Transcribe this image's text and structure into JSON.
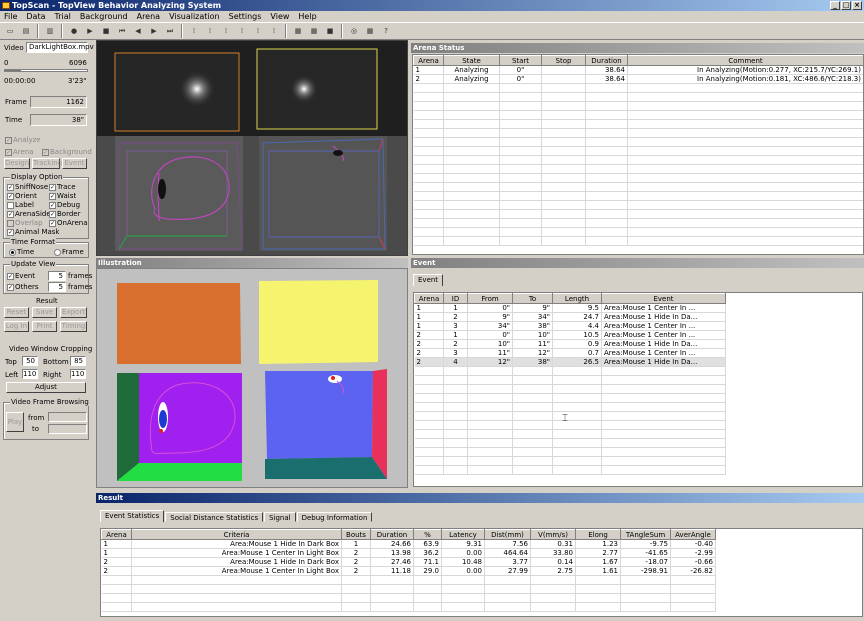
{
  "app": {
    "title": "TopScan - TopView Behavior Analyzing System"
  },
  "window_controls": {
    "minimize": "_",
    "maximize": "□",
    "close": "×"
  },
  "menu": [
    "File",
    "Data",
    "Trial",
    "Background",
    "Arena",
    "Visualization",
    "Settings",
    "View",
    "Help"
  ],
  "toolbar": {
    "icons": [
      "new-icon",
      "open-icon",
      "save-icon",
      "play-icon",
      "record-icon",
      "stop-icon",
      "rewind-icon",
      "back-icon",
      "forward-icon",
      "fast-forward-icon",
      "step1-icon",
      "step2-icon",
      "step3-icon",
      "step4-icon",
      "step5-icon",
      "step6-icon",
      "view1-icon",
      "view2-icon",
      "view3-icon",
      "capture-icon",
      "grid-icon",
      "help-icon"
    ]
  },
  "left": {
    "video_label": "Video",
    "video_file": "DarkLightBox.mpv",
    "slider_min": "0",
    "slider_max": "6096",
    "slider_fraction": 0.19,
    "time_start": "00:00:00",
    "time_end": "3'23\"",
    "frame_label": "Frame",
    "frame_value": "1162",
    "time_label": "Time",
    "time_value": "38\"",
    "analyze": "Analyze",
    "arena": "Arena",
    "background": "Background",
    "design": "Design",
    "tracking": "Tracking",
    "event": "Event",
    "display_option": "Display Option",
    "opts": [
      {
        "label": "SniffNose",
        "checked": true
      },
      {
        "label": "Trace",
        "checked": true
      },
      {
        "label": "Orient",
        "checked": true
      },
      {
        "label": "Waist",
        "checked": true
      },
      {
        "label": "Label",
        "checked": false
      },
      {
        "label": "Debug",
        "checked": true
      },
      {
        "label": "ArenaSide",
        "checked": true
      },
      {
        "label": "Border",
        "checked": true
      },
      {
        "label": "Overlap",
        "checked": false
      },
      {
        "label": "OnArena",
        "checked": true
      },
      {
        "label": "Animal Mask",
        "checked": true
      }
    ],
    "time_format": "Time Format",
    "tf_time": "Time",
    "tf_frame": "Frame",
    "update_view": "Update View",
    "uv_event": "Event",
    "uv_event_n": "5",
    "uv_others": "Others",
    "uv_others_n": "5",
    "frames": "frames",
    "result": "Result",
    "reset": "Reset",
    "save": "Save",
    "export": "Export",
    "login": "Log In",
    "print": "Print",
    "timing": "Timing",
    "cropping": "Video Window Cropping",
    "top": "Top",
    "top_v": "50",
    "bottom": "Bottom",
    "bottom_v": "85",
    "left_l": "Left",
    "left_v": "110",
    "right_l": "Right",
    "right_v": "110",
    "adjust": "Adjust",
    "browsing": "Video Frame Browsing",
    "play": "Play",
    "from": "from",
    "to": "to"
  },
  "illustration_title": "Illustration",
  "arena_status": {
    "title": "Arena Status",
    "columns": [
      "Arena",
      "State",
      "Start",
      "Stop",
      "Duration",
      "Comment"
    ],
    "rows": [
      [
        "1",
        "Analyzing",
        "0\"",
        "",
        "38.64",
        "In Analyzing(Motion:0.277, XC:215.7/YC:269.1)"
      ],
      [
        "2",
        "Analyzing",
        "0\"",
        "",
        "38.64",
        "In Analyzing(Motion:0.181, XC:486.6/YC:218.3)"
      ]
    ]
  },
  "event_panel": {
    "title": "Event",
    "tab": "Event",
    "columns": [
      "Arena",
      "ID",
      "From",
      "To",
      "Length",
      "Event"
    ],
    "rows": [
      [
        "1",
        "1",
        "0\"",
        "9\"",
        "9.5",
        "Area:Mouse 1 Center In ..."
      ],
      [
        "1",
        "2",
        "9\"",
        "34\"",
        "24.7",
        "Area:Mouse 1 Hide In Da..."
      ],
      [
        "1",
        "3",
        "34\"",
        "38\"",
        "4.4",
        "Area:Mouse 1 Center In ..."
      ],
      [
        "2",
        "1",
        "0\"",
        "10\"",
        "10.5",
        "Area:Mouse 1 Center In ..."
      ],
      [
        "2",
        "2",
        "10\"",
        "11\"",
        "0.9",
        "Area:Mouse 1 Hide In Da..."
      ],
      [
        "2",
        "3",
        "11\"",
        "12\"",
        "0.7",
        "Area:Mouse 1 Center In ..."
      ],
      [
        "2",
        "4",
        "12\"",
        "38\"",
        "26.5",
        "Area:Mouse 1 Hide In Da..."
      ]
    ]
  },
  "result_panel": {
    "title": "Result",
    "tabs": [
      "Event Statistics",
      "Social Distance Statistics",
      "Signal",
      "Debug Information"
    ],
    "columns": [
      "Arena",
      "Criteria",
      "Bouts",
      "Duration",
      "%",
      "Latency",
      "Dist(mm)",
      "V(mm/s)",
      "Elong",
      "TAngleSum",
      "AverAngle"
    ],
    "rows": [
      [
        "1",
        "Area:Mouse 1 Hide In Dark Box",
        "1",
        "24.66",
        "63.9",
        "9.31",
        "7.56",
        "0.31",
        "1.23",
        "-9.75",
        "-0.40"
      ],
      [
        "1",
        "Area:Mouse 1 Center In Light Box",
        "2",
        "13.98",
        "36.2",
        "0.00",
        "464.64",
        "33.80",
        "2.77",
        "-41.65",
        "-2.99"
      ],
      [
        "2",
        "Area:Mouse 1 Hide In Dark Box",
        "2",
        "27.46",
        "71.1",
        "10.48",
        "3.77",
        "0.14",
        "1.67",
        "-18.07",
        "-0.66"
      ],
      [
        "2",
        "Area:Mouse 1 Center In Light Box",
        "2",
        "11.18",
        "29.0",
        "0.00",
        "27.99",
        "2.75",
        "1.61",
        "-298.91",
        "-26.82"
      ]
    ]
  },
  "colors": {
    "light_box_1": "#d96f2e",
    "light_box_2": "#f6f46e",
    "dark_floor_1": "#a020f0",
    "dark_floor_2": "#5b63f0",
    "wall_green": "#22dd44",
    "wall_teal": "#1a6e6e",
    "wall_red": "#e8305a",
    "wall_darkgreen": "#1f6b3a"
  }
}
